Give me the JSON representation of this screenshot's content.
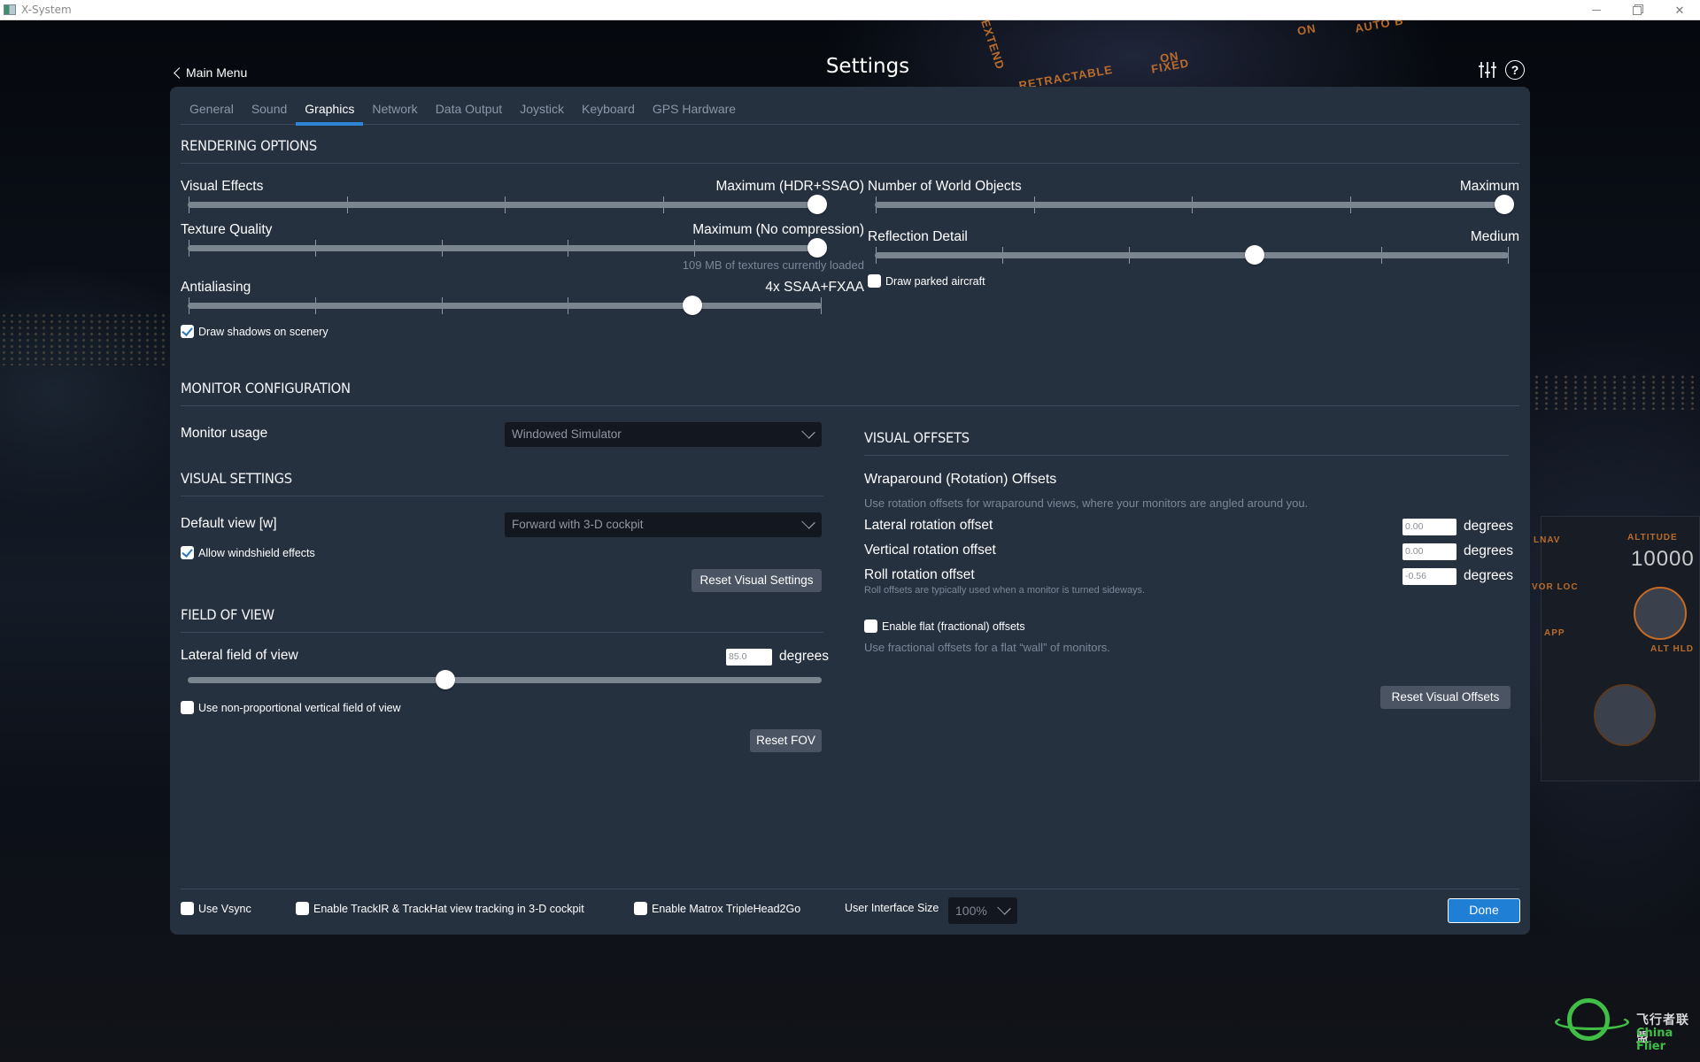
{
  "window": {
    "title": "X-System",
    "controls": [
      "minimize",
      "maximize",
      "close"
    ]
  },
  "header": {
    "back_label": "Main Menu",
    "title": "Settings",
    "icons": [
      "sliders-icon",
      "help-icon"
    ],
    "help_glyph": "?"
  },
  "tabs": [
    {
      "label": "General",
      "active": false
    },
    {
      "label": "Sound",
      "active": false
    },
    {
      "label": "Graphics",
      "active": true
    },
    {
      "label": "Network",
      "active": false
    },
    {
      "label": "Data Output",
      "active": false
    },
    {
      "label": "Joystick",
      "active": false
    },
    {
      "label": "Keyboard",
      "active": false
    },
    {
      "label": "GPS Hardware",
      "active": false
    }
  ],
  "rendering": {
    "title": "RENDERING OPTIONS",
    "visual_effects": {
      "label": "Visual Effects",
      "value": "Maximum (HDR+SSAO)",
      "steps": 4,
      "position": 4
    },
    "texture_quality": {
      "label": "Texture Quality",
      "value": "Maximum (No compression)",
      "steps": 5,
      "position": 5,
      "note": "109 MB of textures currently loaded"
    },
    "antialiasing": {
      "label": "Antialiasing",
      "value": "4x SSAA+FXAA",
      "steps": 5,
      "position": 4
    },
    "draw_shadows": {
      "label": "Draw shadows on scenery",
      "checked": true
    },
    "world_objects": {
      "label": "Number of World Objects",
      "value": "Maximum",
      "steps": 4,
      "position": 4
    },
    "reflection_detail": {
      "label": "Reflection Detail",
      "value": "Medium",
      "steps": 5,
      "position": 3
    },
    "draw_parked_aircraft": {
      "label": "Draw parked aircraft",
      "checked": false
    }
  },
  "monitor": {
    "title": "MONITOR CONFIGURATION",
    "usage_label": "Monitor usage",
    "usage_value": "Windowed Simulator"
  },
  "visual_settings": {
    "title": "VISUAL SETTINGS",
    "default_view_label": "Default view [w]",
    "default_view_value": "Forward with 3-D cockpit",
    "windshield": {
      "label": "Allow windshield effects",
      "checked": true
    },
    "reset_label": "Reset Visual Settings"
  },
  "fov": {
    "title": "FIELD OF VIEW",
    "lateral_label": "Lateral field of view",
    "lateral_value": "85.0",
    "unit": "degrees",
    "slider_fraction": 0.405,
    "non_proportional": {
      "label": "Use non-proportional vertical field of view",
      "checked": false
    },
    "reset_label": "Reset FOV"
  },
  "visual_offsets": {
    "title": "VISUAL OFFSETS",
    "wrap_title": "Wraparound (Rotation) Offsets",
    "wrap_note": "Use rotation offsets for wraparound views, where your monitors are angled around you.",
    "lateral": {
      "label": "Lateral rotation offset",
      "value": "0.00",
      "unit": "degrees"
    },
    "vertical": {
      "label": "Vertical rotation offset",
      "value": "0.00",
      "unit": "degrees"
    },
    "roll": {
      "label": "Roll rotation offset",
      "value": "-0.56",
      "unit": "degrees",
      "note": "Roll offsets are typically used when a monitor is turned sideways."
    },
    "flat": {
      "label": "Enable flat (fractional) offsets",
      "checked": false,
      "note": "Use fractional offsets for a flat “wall” of monitors."
    },
    "reset_label": "Reset Visual Offsets"
  },
  "footer": {
    "vsync": {
      "label": "Use Vsync",
      "checked": false
    },
    "trackir": {
      "label": "Enable TrackIR & TrackHat view tracking in 3-D cockpit",
      "checked": false
    },
    "matrox": {
      "label": "Enable Matrox TripleHead2Go",
      "checked": false
    },
    "ui_size_label": "User Interface Size",
    "ui_size_value": "100%",
    "done_label": "Done"
  },
  "background": {
    "labels": [
      "EXTEND",
      "RETRACTABLE",
      "ON",
      "FIXED",
      "ON",
      "AUTO B",
      "LNAV",
      "VOR LOC",
      "APP",
      "ALTITUDE",
      "10000",
      "ALT HLD"
    ]
  },
  "watermark": {
    "cn": "飞行者联盟",
    "en": "China Flier"
  },
  "colors": {
    "panel": "#263140",
    "accent": "#2f86d6",
    "done": "#1e7fd4",
    "button": "#4a5463"
  }
}
